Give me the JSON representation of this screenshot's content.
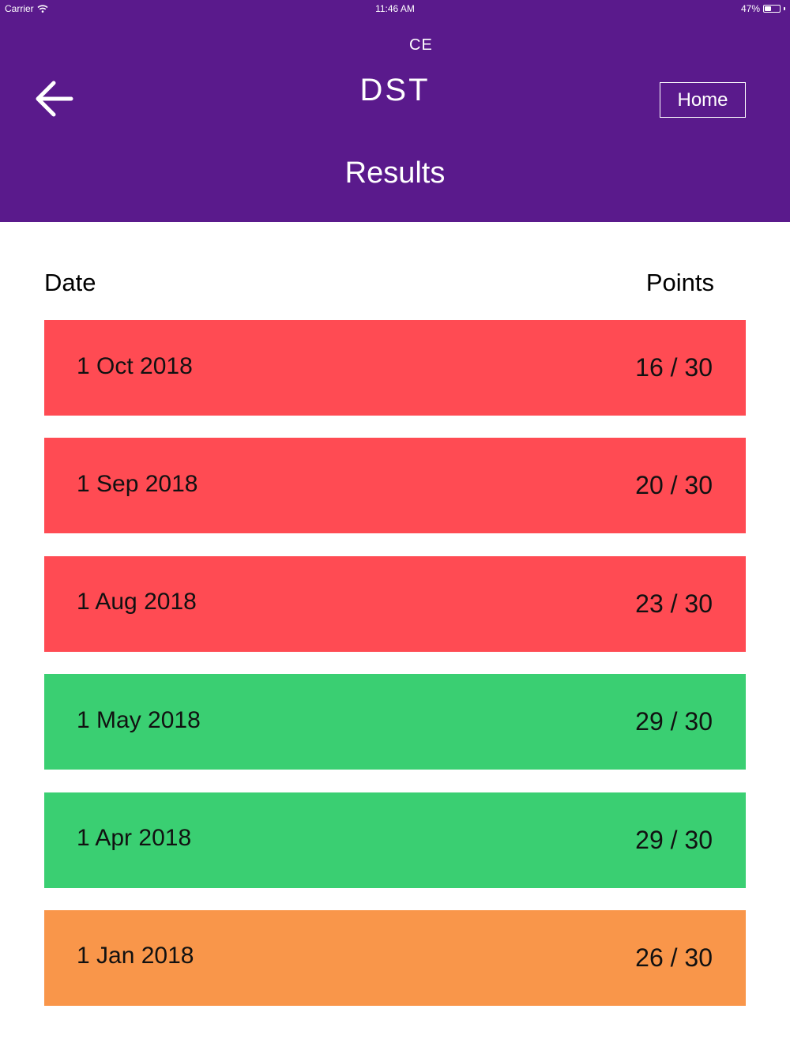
{
  "status_bar": {
    "carrier": "Carrier",
    "time": "11:46 AM",
    "battery": "47%",
    "battery_level": 0.47
  },
  "header": {
    "back_icon": "arrow-left-icon",
    "logo": "DST",
    "logo_mark": "CE",
    "home_label": "Home",
    "title": "Results",
    "background_color": "#5a1a8c"
  },
  "table": {
    "columns": [
      "Date",
      "Points"
    ],
    "rows": [
      {
        "date": "1 Oct 2018",
        "points": "16 / 30",
        "status": "low",
        "color": "#ff4b53"
      },
      {
        "date": "1 Sep 2018",
        "points": "20 / 30",
        "status": "low",
        "color": "#ff4b53"
      },
      {
        "date": "1 Aug 2018",
        "points": "23 / 30",
        "status": "low",
        "color": "#ff4b53"
      },
      {
        "date": "1 May 2018",
        "points": "29 / 30",
        "status": "high",
        "color": "#3acf72"
      },
      {
        "date": "1 Apr 2018",
        "points": "29 / 30",
        "status": "high",
        "color": "#3acf72"
      },
      {
        "date": "1 Jan 2018",
        "points": "26 / 30",
        "status": "medium",
        "color": "#f9964a"
      }
    ]
  }
}
